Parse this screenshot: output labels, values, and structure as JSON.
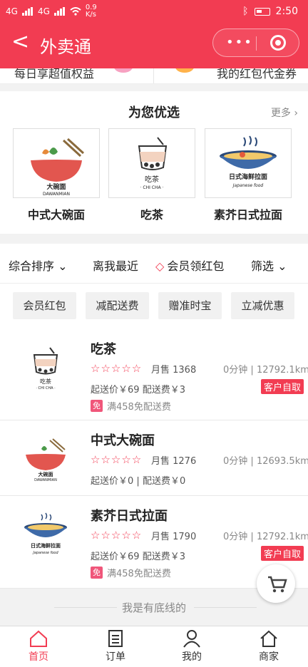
{
  "status": {
    "signal": "4G",
    "signal2": "4G",
    "speed": "0.9",
    "speed_unit": "K/s",
    "time": "2:50"
  },
  "nav": {
    "title": "外卖通",
    "back": "<"
  },
  "top_cards": {
    "left": "每日享超值权益",
    "right": "我的红包代金券"
  },
  "recommend": {
    "title": "为您优选",
    "more": "更多",
    "items": [
      {
        "name": "中式大碗面",
        "logo_text": "大碗面",
        "logo_sub": "DAWANMIAN"
      },
      {
        "name": "吃茶",
        "logo_text": "吃茶",
        "logo_sub": "· CHI CHA ·"
      },
      {
        "name": "素芥日式拉面",
        "logo_text": "日式海鲜拉面",
        "logo_sub": "Japanese food"
      }
    ]
  },
  "filters": {
    "sort": "综合排序",
    "nearest": "离我最近",
    "member": "会员领红包",
    "screen": "筛选"
  },
  "tags": [
    "会员红包",
    "减配送费",
    "赠准时宝",
    "立减优惠"
  ],
  "stores": [
    {
      "name": "吃茶",
      "sales": "月售 1368",
      "time": "0分钟",
      "distance": "12792.1km",
      "min_order": "起送价￥69",
      "delivery": "配送费￥3",
      "self_pickup": "客户自取",
      "promo": "满458免配送费",
      "promo_badge": "免"
    },
    {
      "name": "中式大碗面",
      "sales": "月售 1276",
      "time": "0分钟",
      "distance": "12693.5km",
      "min_order": "起送价￥0",
      "delivery": "配送费￥0"
    },
    {
      "name": "素芥日式拉面",
      "sales": "月售 1790",
      "time": "0分钟",
      "distance": "12792.1km",
      "min_order": "起送价￥69",
      "delivery": "配送费￥3",
      "self_pickup": "客户自取",
      "promo": "满458免配送费",
      "promo_badge": "免"
    }
  ],
  "stars": "☆☆☆☆☆",
  "bottom_text": "我是有底线的",
  "tabbar": [
    {
      "label": "首页",
      "icon": "home-icon",
      "active": true
    },
    {
      "label": "订单",
      "icon": "order-icon",
      "active": false
    },
    {
      "label": "我的",
      "icon": "user-icon",
      "active": false
    },
    {
      "label": "商家",
      "icon": "shop-icon",
      "active": false
    }
  ],
  "colors": {
    "brand": "#f23c52",
    "badge": "#f0567a"
  }
}
